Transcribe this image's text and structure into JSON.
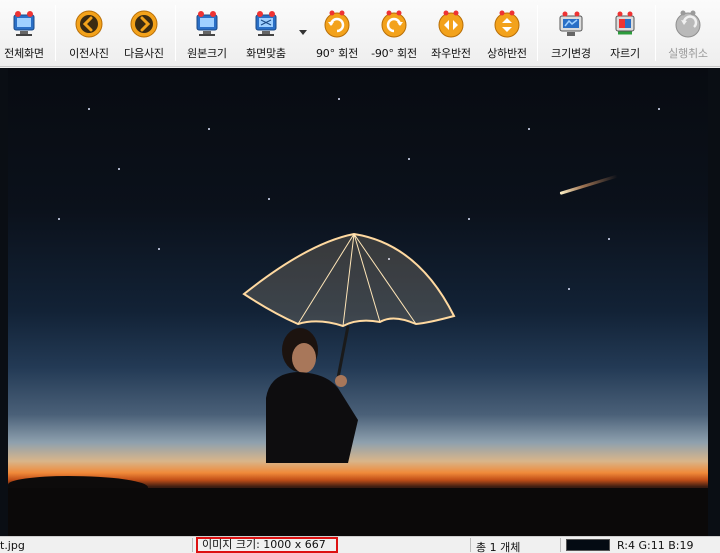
{
  "toolbar": {
    "buttons": [
      {
        "id": "fullscreen",
        "label": "전체화면",
        "icon": "monitor-icon",
        "enabled": true
      },
      {
        "id": "prev",
        "label": "이전사진",
        "icon": "arrow-left-icon",
        "enabled": true
      },
      {
        "id": "next",
        "label": "다음사진",
        "icon": "arrow-right-icon",
        "enabled": true
      },
      {
        "id": "original",
        "label": "원본크기",
        "icon": "monitor-icon",
        "enabled": true
      },
      {
        "id": "fit",
        "label": "화면맞춤",
        "icon": "monitor-fit-icon",
        "enabled": true
      },
      {
        "id": "rotate90",
        "label": "90° 회전",
        "icon": "rotate-cw-icon",
        "enabled": true
      },
      {
        "id": "rotate-90",
        "label": "-90° 회전",
        "icon": "rotate-ccw-icon",
        "enabled": true
      },
      {
        "id": "flip-h",
        "label": "좌우반전",
        "icon": "flip-horizontal-icon",
        "enabled": true
      },
      {
        "id": "flip-v",
        "label": "상하반전",
        "icon": "flip-vertical-icon",
        "enabled": true
      },
      {
        "id": "resize",
        "label": "크기변경",
        "icon": "resize-icon",
        "enabled": true
      },
      {
        "id": "crop",
        "label": "자르기",
        "icon": "crop-icon",
        "enabled": true
      },
      {
        "id": "undo",
        "label": "실행취소",
        "icon": "undo-icon",
        "enabled": false
      }
    ]
  },
  "status": {
    "filename": "t.jpg",
    "image_size": "이미지 크기: 1000 x 667",
    "count": "총 1 개체",
    "pixel_color": "#04 0b 13",
    "pixel_swatch_color": "#040b13",
    "rgb": "R:4 G:11 B:19"
  },
  "colors": {
    "highlight_border": "#dd1111",
    "icon_orange": "#f3a21b",
    "icon_blue": "#2a6fc6"
  }
}
